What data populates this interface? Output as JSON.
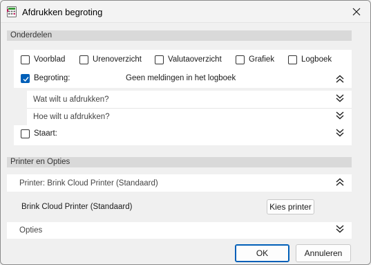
{
  "window": {
    "title": "Afdrukken begroting"
  },
  "icons": {
    "app": "calculator-sheet-icon",
    "close": "close-icon",
    "collapse": "double-chevron-up-icon",
    "expand": "double-chevron-down-icon"
  },
  "colors": {
    "accent": "#005fb8",
    "section_header_bg": "#d9d9d9",
    "panel_bg": "#ffffff",
    "window_bg": "#f0f0f0"
  },
  "onderdelen": {
    "header": "Onderdelen",
    "options": [
      {
        "label": "Voorblad",
        "checked": false
      },
      {
        "label": "Urenoverzicht",
        "checked": false
      },
      {
        "label": "Valutaoverzicht",
        "checked": false
      },
      {
        "label": "Grafiek",
        "checked": false
      },
      {
        "label": "Logboek",
        "checked": false
      }
    ],
    "begroting": {
      "label": "Begroting:",
      "checked": true,
      "message": "Geen meldingen in het logboek"
    },
    "sub_rows": [
      {
        "label": "Wat wilt u afdrukken?"
      },
      {
        "label": "Hoe wilt u afdrukken?"
      }
    ],
    "staart": {
      "label": "Staart:",
      "checked": false
    }
  },
  "printer": {
    "header": "Printer en Opties",
    "row_label": "Printer: Brink Cloud Printer (Standaard)",
    "selected_printer": "Brink Cloud Printer (Standaard)",
    "choose_button": "Kies printer",
    "options_label": "Opties"
  },
  "footer": {
    "ok_label": "OK",
    "cancel_label": "Annuleren"
  }
}
